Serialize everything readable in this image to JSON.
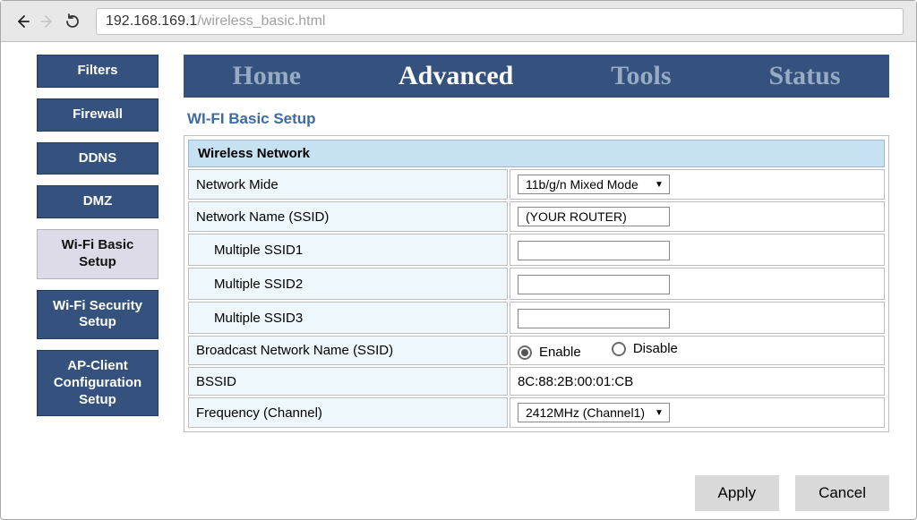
{
  "browser": {
    "url_host": "192.168.169.1",
    "url_path": "/wireless_basic.html"
  },
  "sidebar": {
    "items": [
      {
        "label": "Filters",
        "active": false
      },
      {
        "label": "Firewall",
        "active": false
      },
      {
        "label": "DDNS",
        "active": false
      },
      {
        "label": "DMZ",
        "active": false
      },
      {
        "label": "Wi-Fi Basic Setup",
        "active": true
      },
      {
        "label": "Wi-Fi Security Setup",
        "active": false
      },
      {
        "label": "AP-Client Configuration Setup",
        "active": false
      }
    ]
  },
  "topnav": {
    "items": [
      {
        "label": "Home",
        "active": false
      },
      {
        "label": "Advanced",
        "active": true
      },
      {
        "label": "Tools",
        "active": false
      },
      {
        "label": "Status",
        "active": false
      }
    ]
  },
  "section_title": "WI-FI Basic Setup",
  "table": {
    "header": "Wireless Network",
    "rows": {
      "network_mode_label": "Network Mide",
      "network_mode_value": "11b/g/n Mixed Mode",
      "ssid_label": "Network Name (SSID)",
      "ssid_value": "(YOUR ROUTER)",
      "mssid1_label": "Multiple SSID1",
      "mssid1_value": "",
      "mssid2_label": "Multiple SSID2",
      "mssid2_value": "",
      "mssid3_label": "Multiple SSID3",
      "mssid3_value": "",
      "broadcast_label": "Broadcast Network Name (SSID)",
      "broadcast_enable": "Enable",
      "broadcast_disable": "Disable",
      "bssid_label": "BSSID",
      "bssid_value": "8C:88:2B:00:01:CB",
      "freq_label": "Frequency (Channel)",
      "freq_value": "2412MHz (Channel1)"
    }
  },
  "actions": {
    "apply": "Apply",
    "cancel": "Cancel"
  }
}
